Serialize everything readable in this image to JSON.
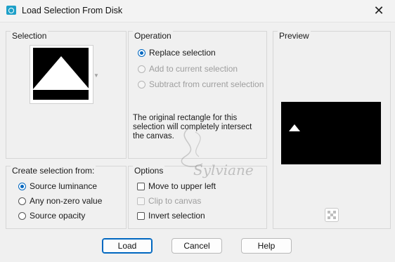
{
  "window": {
    "title": "Load Selection From Disk",
    "close_glyph": "✕"
  },
  "selection": {
    "title": "Selection"
  },
  "operation": {
    "title": "Operation",
    "options": [
      {
        "label": "Replace selection",
        "checked": true,
        "enabled": true
      },
      {
        "label": "Add to current selection",
        "checked": false,
        "enabled": false
      },
      {
        "label": "Subtract from current selection",
        "checked": false,
        "enabled": false
      }
    ],
    "note": "The original rectangle for this selection will completely intersect the canvas."
  },
  "preview": {
    "title": "Preview"
  },
  "create_from": {
    "title": "Create selection from:",
    "options": [
      {
        "label": "Source luminance",
        "checked": true
      },
      {
        "label": "Any non-zero value",
        "checked": false
      },
      {
        "label": "Source opacity",
        "checked": false
      }
    ]
  },
  "options": {
    "title": "Options",
    "items": [
      {
        "label": "Move to upper left",
        "checked": false,
        "enabled": true
      },
      {
        "label": "Clip to canvas",
        "checked": false,
        "enabled": false
      },
      {
        "label": "Invert selection",
        "checked": false,
        "enabled": true
      }
    ]
  },
  "buttons": {
    "load": "Load",
    "cancel": "Cancel",
    "help": "Help"
  },
  "watermark": "Sylviane",
  "colors": {
    "accent": "#0067c0",
    "preview_bg": "#000000",
    "app_icon": "#1ea0c8"
  },
  "icons": {
    "app": "load-selection-app-icon",
    "zoom": "checker-zoom-icon"
  }
}
